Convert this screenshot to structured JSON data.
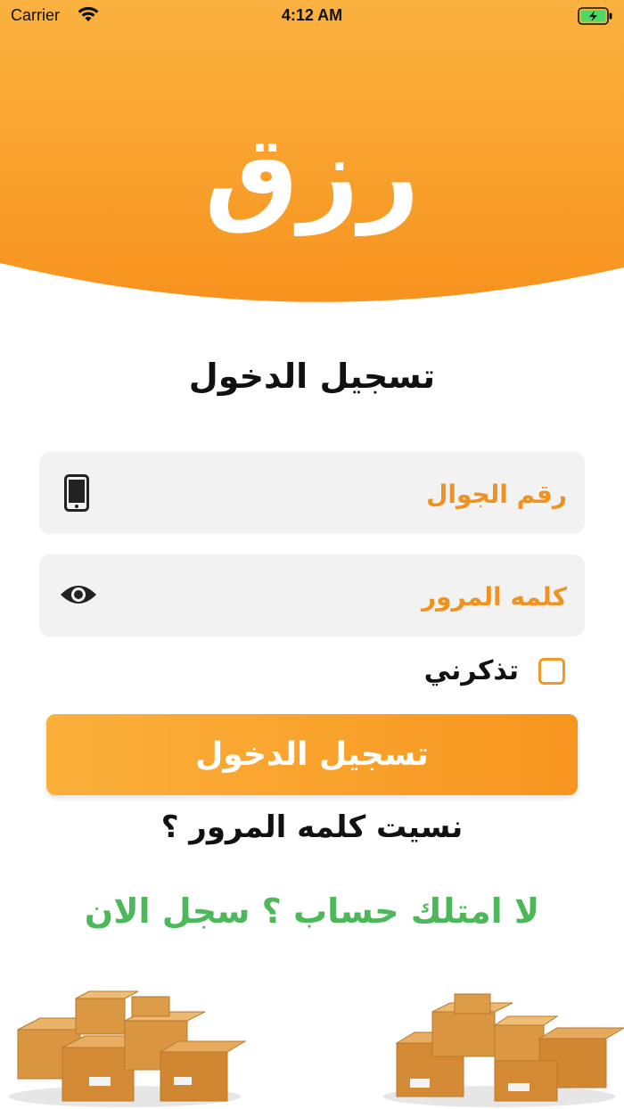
{
  "status_bar": {
    "carrier": "Carrier",
    "time": "4:12 AM"
  },
  "app": {
    "logo_text": "رزق",
    "brand_color": "#f7961f",
    "brand_light": "#fbb03b"
  },
  "login": {
    "title": "تسجيل الدخول",
    "phone_placeholder": "رقم الجوال",
    "password_placeholder": "كلمه المرور",
    "remember_label": "تذكرني",
    "submit_label": "تسجيل الدخول",
    "forgot_label": "نسيت كلمه المرور ؟",
    "signup_label": "لا امتلك حساب ؟ سجل الان"
  },
  "icons": {
    "phone": "mobile-phone-icon",
    "password": "eye-icon",
    "wifi": "wifi-icon",
    "battery": "battery-charging-icon"
  },
  "colors": {
    "signup_green": "#4db85a",
    "field_bg": "#f2f2f2",
    "placeholder_orange": "#f0921f"
  }
}
